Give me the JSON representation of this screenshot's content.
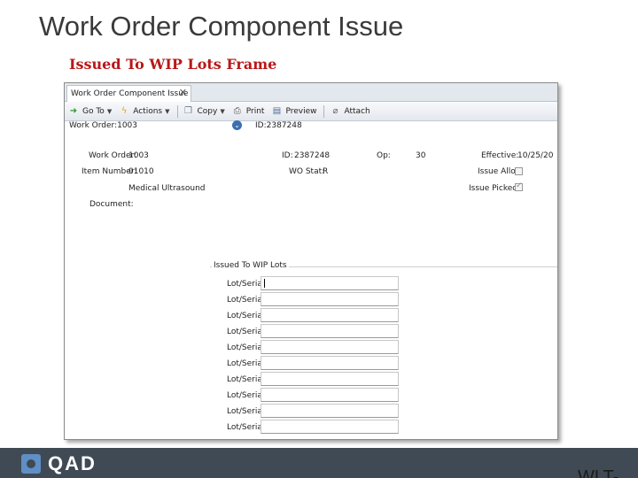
{
  "slide": {
    "title": "Work Order Component Issue",
    "subtitle": "Issued To WIP Lots Frame",
    "logo_text": "QAD",
    "corner_text": "WLT-"
  },
  "window": {
    "tab_label": "Work Order Component Issue",
    "close_glyph": "✕",
    "toolbar": {
      "goto_label": "Go To",
      "actions_label": "Actions",
      "copy_label": "Copy",
      "print_label": "Print",
      "preview_label": "Preview",
      "attach_label": "Attach"
    },
    "info_left": "Work Order:1003",
    "info_id": "ID:2387248",
    "fields": {
      "work_order_label": "Work Order:",
      "work_order_value": "1003",
      "id_label": "ID:",
      "id_value": "2387248",
      "op_label": "Op:",
      "op_value": "30",
      "effective_label": "Effective:",
      "effective_value": "10/25/20",
      "item_number_label": "Item Number:",
      "item_number_value": "01010",
      "wo_status_label": "WO Stat:",
      "wo_status_value": "R",
      "issue_alloc_label": "Issue Alloc:",
      "issue_picked_label": "Issue Picked:",
      "description_value": "Medical Ultrasound",
      "document_label": "Document:"
    },
    "issued_frame": {
      "title": "Issued To WIP Lots",
      "lot_label": "Lot/Serial:",
      "rows": [
        "Lot/Serial:",
        "Lot/Serial:",
        "Lot/Serial:",
        "Lot/Serial:",
        "Lot/Serial:",
        "Lot/Serial:",
        "Lot/Serial:",
        "Lot/Serial:",
        "Lot/Serial:",
        "Lot/Serial:"
      ]
    }
  },
  "colors": {
    "subtitle": "#b81818",
    "footer": "#3f4a54",
    "logo_mark": "#5f8fc4"
  }
}
